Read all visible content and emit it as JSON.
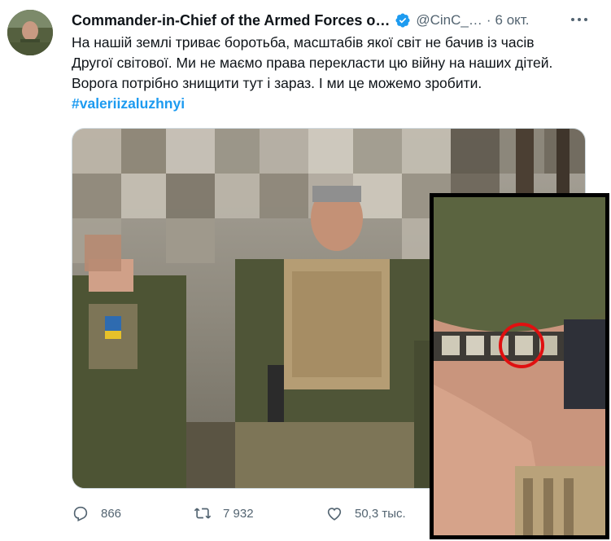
{
  "tweet": {
    "author_name": "Commander-in-Chief of the Armed Forces o…",
    "handle": "@CinC_…",
    "separator": "·",
    "time": "6 окт.",
    "text_lines": [
      "На нашій землі триває боротьба, масштабів якої світ не бачив із часів",
      "Другої світової. Ми не маємо права перекласти цю війну на наших дітей.",
      "Ворога потрібно знищити тут і зараз. І ми це можемо зробити."
    ],
    "hashtag": "#valeriizaluzhnyi"
  },
  "actions": {
    "replies": "866",
    "retweets": "7 932",
    "likes": "50,3 тыс."
  },
  "icons": {
    "verified": "verified-badge-icon",
    "more": "more-options-icon",
    "reply": "reply-icon",
    "retweet": "retweet-icon",
    "like": "like-icon",
    "share": "share-icon"
  },
  "colors": {
    "accent": "#1d9bf0",
    "inset_highlight": "#e01010"
  }
}
